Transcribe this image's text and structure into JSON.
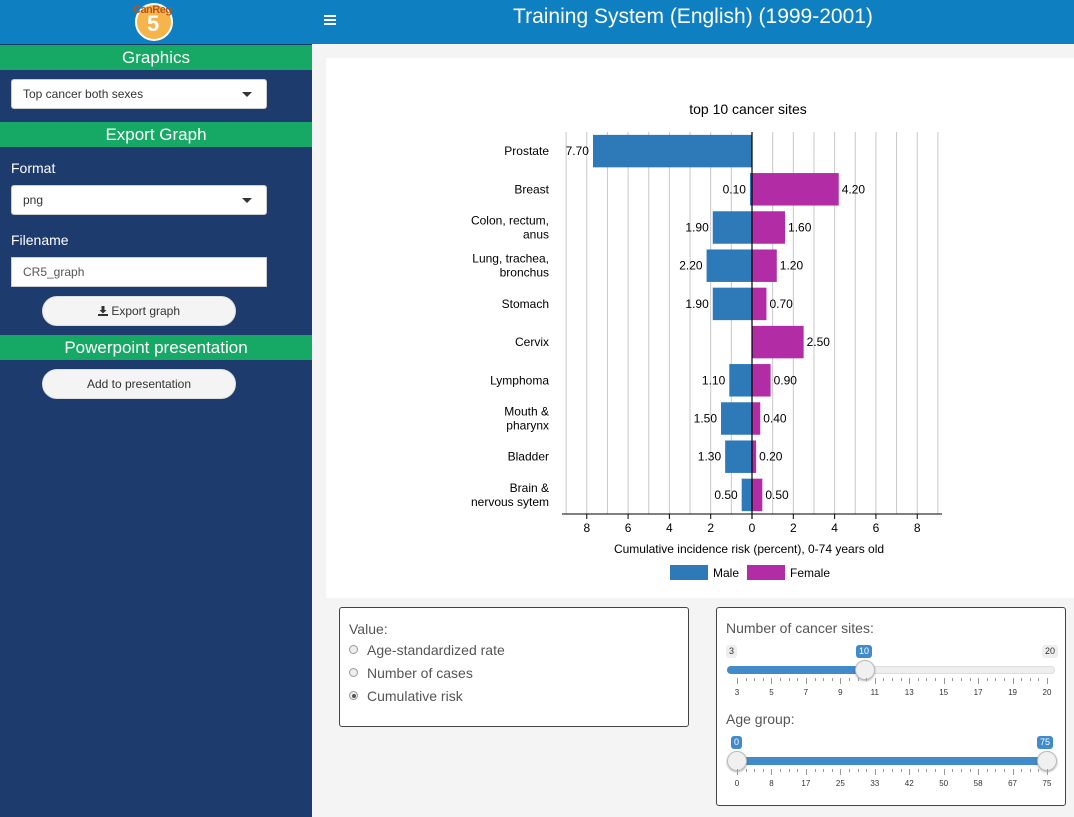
{
  "header": {
    "logo_text": "CanReg",
    "logo_number": "5",
    "menu_icon": "hamburger-icon",
    "title": "Training System (English) (1999-2001)"
  },
  "sidebar": {
    "graphics_title": "Graphics",
    "graph_select": "Top cancer both sexes",
    "export_title": "Export Graph",
    "format_label": "Format",
    "format_value": "png",
    "filename_label": "Filename",
    "filename_value": "CR5_graph",
    "export_button": "Export graph",
    "export_icon": "download-icon",
    "ppt_title": "Powerpoint presentation",
    "ppt_button": "Add to presentation"
  },
  "value_panel": {
    "title": "Value:",
    "options": [
      "Age-standardized rate",
      "Number of cases",
      "Cumulative risk"
    ],
    "selected": 2
  },
  "sliders": {
    "sites_title": "Number of cancer sites:",
    "sites_min": "3",
    "sites_max": "20",
    "sites_value": "10",
    "sites_value_num": 10,
    "sites_ticks": [
      "3",
      "5",
      "7",
      "9",
      "11",
      "13",
      "15",
      "17",
      "19",
      "20"
    ],
    "age_title": "Age group:",
    "age_low": "0",
    "age_high": "75",
    "age_ticks": [
      "0",
      "8",
      "17",
      "25",
      "33",
      "42",
      "50",
      "58",
      "67",
      "75"
    ]
  },
  "colors": {
    "male": "#2e7ab8",
    "female": "#b12ca5"
  },
  "chart_data": {
    "type": "bar",
    "orientation": "horizontal-pyramid",
    "title": "top 10 cancer sites",
    "xlabel": "Cumulative incidence risk (percent), 0-74 years old",
    "xlim": [
      -9.2,
      9.2
    ],
    "xticks": [
      -8,
      -6,
      -4,
      -2,
      0,
      2,
      4,
      6,
      8
    ],
    "xtick_labels": [
      "8",
      "6",
      "4",
      "2",
      "0",
      "2",
      "4",
      "6",
      "8"
    ],
    "grid": true,
    "legend_position": "bottom",
    "categories": [
      [
        "Prostate"
      ],
      [
        "Breast"
      ],
      [
        "Colon, rectum,",
        "anus"
      ],
      [
        "Lung, trachea,",
        "bronchus"
      ],
      [
        "Stomach"
      ],
      [
        "Cervix"
      ],
      [
        "Lymphoma"
      ],
      [
        "Mouth &",
        "pharynx"
      ],
      [
        "Bladder"
      ],
      [
        "Brain &",
        "nervous sytem"
      ]
    ],
    "series": [
      {
        "name": "Male",
        "values": [
          7.7,
          0.1,
          1.9,
          2.2,
          1.9,
          null,
          1.1,
          1.5,
          1.3,
          0.5
        ],
        "labels": [
          "7.70",
          "0.10",
          "1.90",
          "2.20",
          "1.90",
          null,
          "1.10",
          "1.50",
          "1.30",
          "0.50"
        ]
      },
      {
        "name": "Female",
        "values": [
          null,
          4.2,
          1.6,
          1.2,
          0.7,
          2.5,
          0.9,
          0.4,
          0.2,
          0.5
        ],
        "labels": [
          null,
          "4.20",
          "1.60",
          "1.20",
          "0.70",
          "2.50",
          "0.90",
          "0.40",
          "0.20",
          "0.50"
        ]
      }
    ]
  }
}
